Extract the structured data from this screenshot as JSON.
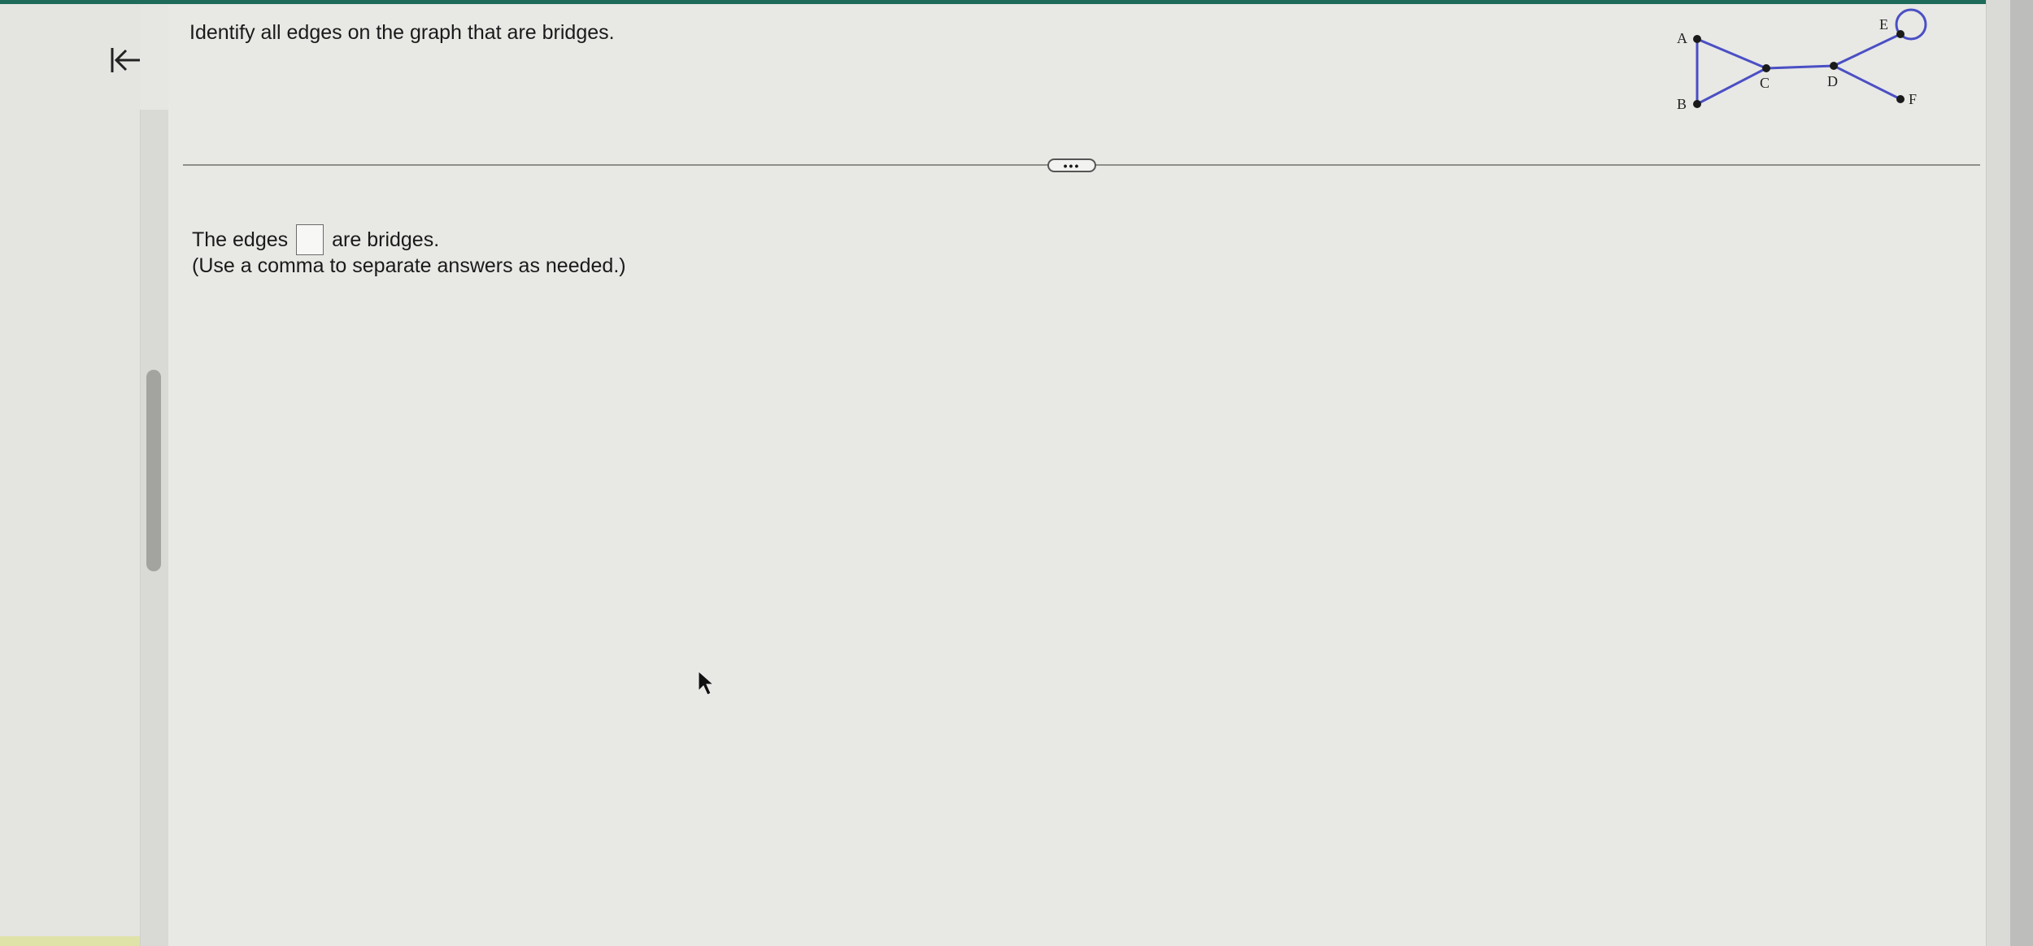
{
  "toolbar": {
    "collapse_icon": "collapse-left-icon"
  },
  "question": {
    "prompt": "Identify all edges on the graph that are bridges."
  },
  "graph": {
    "vertices": [
      "A",
      "B",
      "C",
      "D",
      "E",
      "F"
    ],
    "edges": [
      [
        "A",
        "B"
      ],
      [
        "A",
        "C"
      ],
      [
        "B",
        "C"
      ],
      [
        "C",
        "D"
      ],
      [
        "D",
        "E"
      ],
      [
        "D",
        "F"
      ],
      [
        "E",
        "E"
      ]
    ],
    "edge_color": "#4a4fc4"
  },
  "divider": {
    "expand_label": "•••"
  },
  "answer": {
    "prefix": "The edges",
    "value": "",
    "suffix": "are bridges.",
    "hint": "(Use a comma to separate answers as needed.)"
  },
  "colors": {
    "accent": "#1f6b5a",
    "background": "#e8e8e5"
  }
}
